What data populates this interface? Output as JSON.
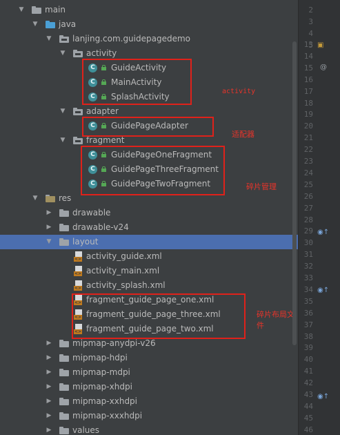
{
  "tree": {
    "main": "main",
    "java": "java",
    "package": "lanjing.com.guidepagedemo",
    "activity_pkg": "activity",
    "guide_activity": "GuideActivity",
    "main_activity": "MainActivity",
    "splash_activity": "SplashActivity",
    "adapter_pkg": "adapter",
    "guide_page_adapter": "GuidePageAdapter",
    "fragment_pkg": "fragment",
    "frag_one": "GuidePageOneFragment",
    "frag_three": "GuidePageThreeFragment",
    "frag_two": "GuidePageTwoFragment",
    "res": "res",
    "drawable": "drawable",
    "drawable_v24": "drawable-v24",
    "layout": "layout",
    "activity_guide_xml": "activity_guide.xml",
    "activity_main_xml": "activity_main.xml",
    "activity_splash_xml": "activity_splash.xml",
    "frag_one_xml": "fragment_guide_page_one.xml",
    "frag_three_xml": "fragment_guide_page_three.xml",
    "frag_two_xml": "fragment_guide_page_two.xml",
    "mipmap_anydpi": "mipmap-anydpi-v26",
    "mipmap_hdpi": "mipmap-hdpi",
    "mipmap_mdpi": "mipmap-mdpi",
    "mipmap_xhdpi": "mipmap-xhdpi",
    "mipmap_xxhdpi": "mipmap-xxhdpi",
    "mipmap_xxxhdpi": "mipmap-xxxhdpi",
    "values": "values"
  },
  "annotations": {
    "activity": "activity",
    "adapter": "适配器",
    "fragment": "碎片管理",
    "layout": "碎片布局文件"
  },
  "icons": {
    "class_letter": "C",
    "xml_tag": "<>",
    "override": "@"
  },
  "gutter": {
    "line_numbers": [
      "2",
      "3",
      "4",
      "5",
      "13",
      "14",
      "15",
      "16",
      "17",
      "18",
      "19",
      "20",
      "21",
      "22",
      "23",
      "24",
      "25",
      "26",
      "27",
      "28",
      "29",
      "30",
      "31",
      "32",
      "33",
      "34",
      "35",
      "36",
      "37",
      "38",
      "39",
      "40",
      "41",
      "42",
      "43",
      "44",
      "45",
      "46"
    ]
  },
  "colors": {
    "panel_bg": "#3c3f41",
    "selected_row": "#4b6eaf",
    "highlight_box": "#e0211a",
    "annotation_text": "#e8342a"
  }
}
